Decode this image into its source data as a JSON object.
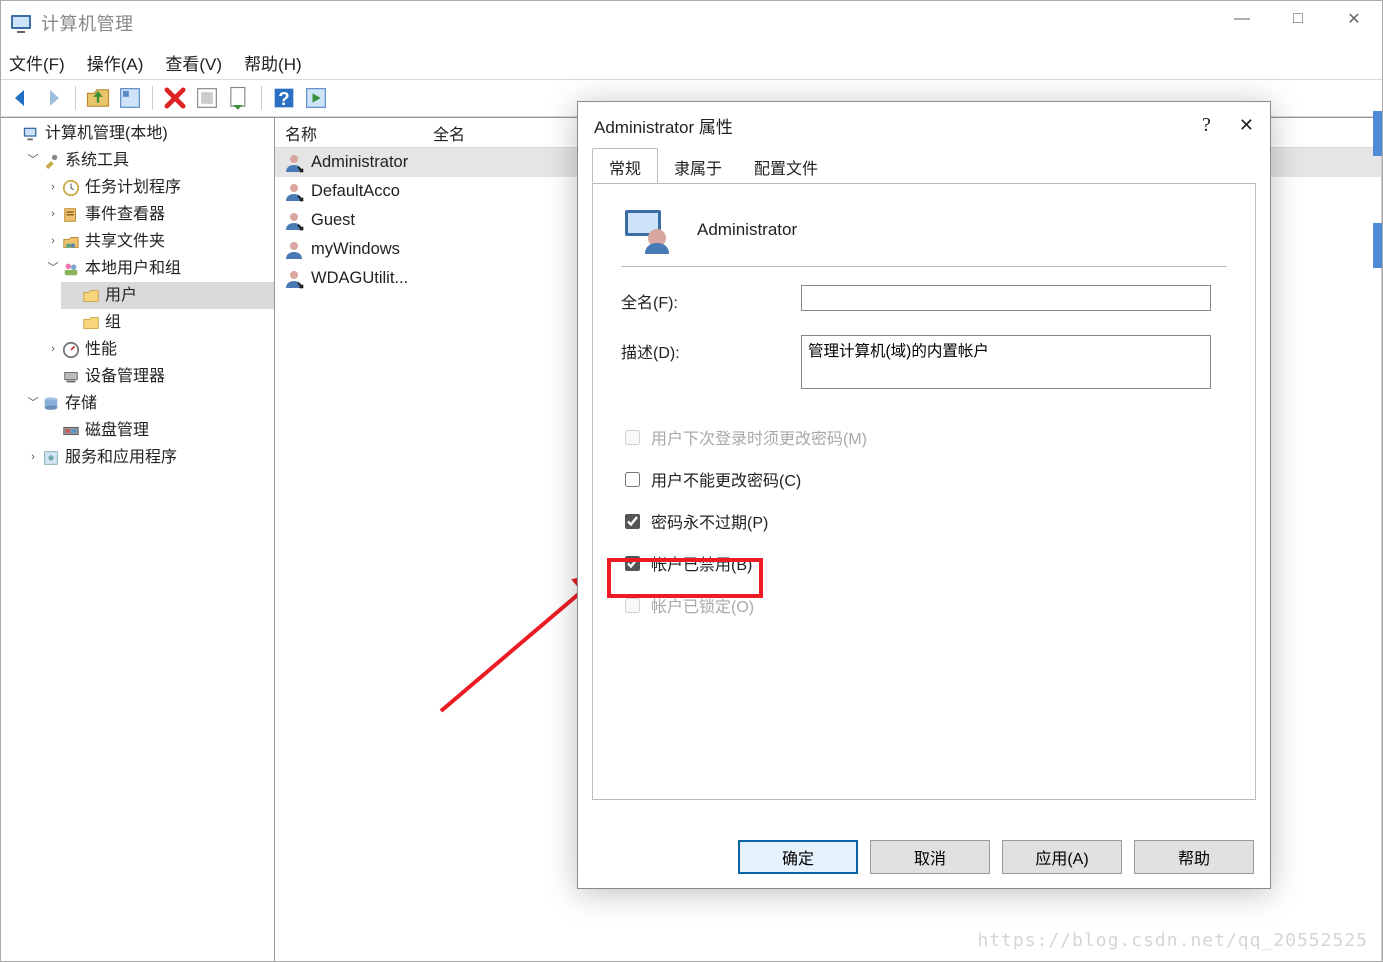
{
  "window": {
    "title": "计算机管理",
    "min": "—",
    "max": "□",
    "close": "✕"
  },
  "menu": {
    "file": "文件(F)",
    "action": "操作(A)",
    "view": "查看(V)",
    "help": "帮助(H)"
  },
  "tree": {
    "root": "计算机管理(本地)",
    "system_tools": "系统工具",
    "task_scheduler": "任务计划程序",
    "event_viewer": "事件查看器",
    "shared_folders": "共享文件夹",
    "local_users": "本地用户和组",
    "users": "用户",
    "groups": "组",
    "performance": "性能",
    "device_manager": "设备管理器",
    "storage": "存储",
    "disk_mgmt": "磁盘管理",
    "services_apps": "服务和应用程序"
  },
  "list": {
    "col_name": "名称",
    "col_full": "全名",
    "rows": [
      {
        "name": "Administrator"
      },
      {
        "name": "DefaultAcco"
      },
      {
        "name": "Guest"
      },
      {
        "name": "myWindows"
      },
      {
        "name": "WDAGUtilit..."
      }
    ]
  },
  "dialog": {
    "title": "Administrator 属性",
    "help": "?",
    "close": "✕",
    "tabs": {
      "general": "常规",
      "memberof": "隶属于",
      "profile": "配置文件"
    },
    "username": "Administrator",
    "lbl_fullname": "全名(F):",
    "val_fullname": "",
    "lbl_desc": "描述(D):",
    "val_desc": "管理计算机(域)的内置帐户",
    "chk_must_change": "用户下次登录时须更改密码(M)",
    "chk_cannot_change": "用户不能更改密码(C)",
    "chk_never_expire": "密码永不过期(P)",
    "chk_disabled": "帐户已禁用(B)",
    "chk_locked": "帐户已锁定(O)",
    "buttons": {
      "ok": "确定",
      "cancel": "取消",
      "apply": "应用(A)",
      "help": "帮助"
    }
  },
  "watermark": "https://blog.csdn.net/qq_20552525"
}
